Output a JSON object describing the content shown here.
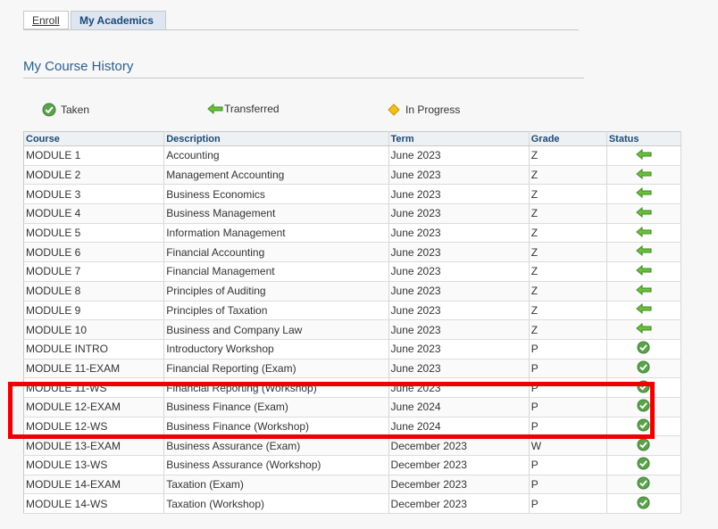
{
  "tabs": [
    {
      "label": "Enroll"
    },
    {
      "label": "My Academics"
    }
  ],
  "page_title": "My Course History",
  "legend": {
    "taken": "Taken",
    "transferred": "Transferred",
    "in_progress": "In Progress"
  },
  "colors": {
    "taken": "#5aa34b",
    "transferred": "#6cbf3c",
    "in_progress": "#f2c018",
    "highlight": "#ee0000"
  },
  "table": {
    "headers": [
      "Course",
      "Description",
      "Term",
      "Grade",
      "Status"
    ],
    "rows": [
      {
        "course": "MODULE 1",
        "description": "Accounting",
        "term": "June 2023",
        "grade": "Z",
        "status": "transferred"
      },
      {
        "course": "MODULE 2",
        "description": "Management Accounting",
        "term": "June 2023",
        "grade": "Z",
        "status": "transferred"
      },
      {
        "course": "MODULE 3",
        "description": "Business Economics",
        "term": "June 2023",
        "grade": "Z",
        "status": "transferred"
      },
      {
        "course": "MODULE 4",
        "description": "Business Management",
        "term": "June 2023",
        "grade": "Z",
        "status": "transferred"
      },
      {
        "course": "MODULE 5",
        "description": "Information Management",
        "term": "June 2023",
        "grade": "Z",
        "status": "transferred"
      },
      {
        "course": "MODULE 6",
        "description": "Financial Accounting",
        "term": "June 2023",
        "grade": "Z",
        "status": "transferred"
      },
      {
        "course": "MODULE 7",
        "description": "Financial Management",
        "term": "June 2023",
        "grade": "Z",
        "status": "transferred"
      },
      {
        "course": "MODULE 8",
        "description": "Principles of Auditing",
        "term": "June 2023",
        "grade": "Z",
        "status": "transferred"
      },
      {
        "course": "MODULE 9",
        "description": "Principles of Taxation",
        "term": "June 2023",
        "grade": "Z",
        "status": "transferred"
      },
      {
        "course": "MODULE 10",
        "description": "Business and Company Law",
        "term": "June 2023",
        "grade": "Z",
        "status": "transferred"
      },
      {
        "course": "MODULE INTRO",
        "description": "Introductory Workshop",
        "term": "June 2023",
        "grade": "P",
        "status": "taken"
      },
      {
        "course": "MODULE 11-EXAM",
        "description": "Financial Reporting (Exam)",
        "term": "June 2023",
        "grade": "P",
        "status": "taken"
      },
      {
        "course": "MODULE 11-WS",
        "description": "Financial Reporting (Workshop)",
        "term": "June 2023",
        "grade": "P",
        "status": "taken"
      },
      {
        "course": "MODULE 12-EXAM",
        "description": "Business Finance (Exam)",
        "term": "June 2024",
        "grade": "P",
        "status": "taken"
      },
      {
        "course": "MODULE 12-WS",
        "description": "Business Finance (Workshop)",
        "term": "June 2024",
        "grade": "P",
        "status": "taken"
      },
      {
        "course": "MODULE 13-EXAM",
        "description": "Business Assurance (Exam)",
        "term": "December 2023",
        "grade": "W",
        "status": "taken"
      },
      {
        "course": "MODULE 13-WS",
        "description": "Business Assurance (Workshop)",
        "term": "December 2023",
        "grade": "P",
        "status": "taken"
      },
      {
        "course": "MODULE 14-EXAM",
        "description": "Taxation (Exam)",
        "term": "December 2023",
        "grade": "P",
        "status": "taken"
      },
      {
        "course": "MODULE 14-WS",
        "description": "Taxation (Workshop)",
        "term": "December 2023",
        "grade": "P",
        "status": "taken"
      }
    ]
  }
}
